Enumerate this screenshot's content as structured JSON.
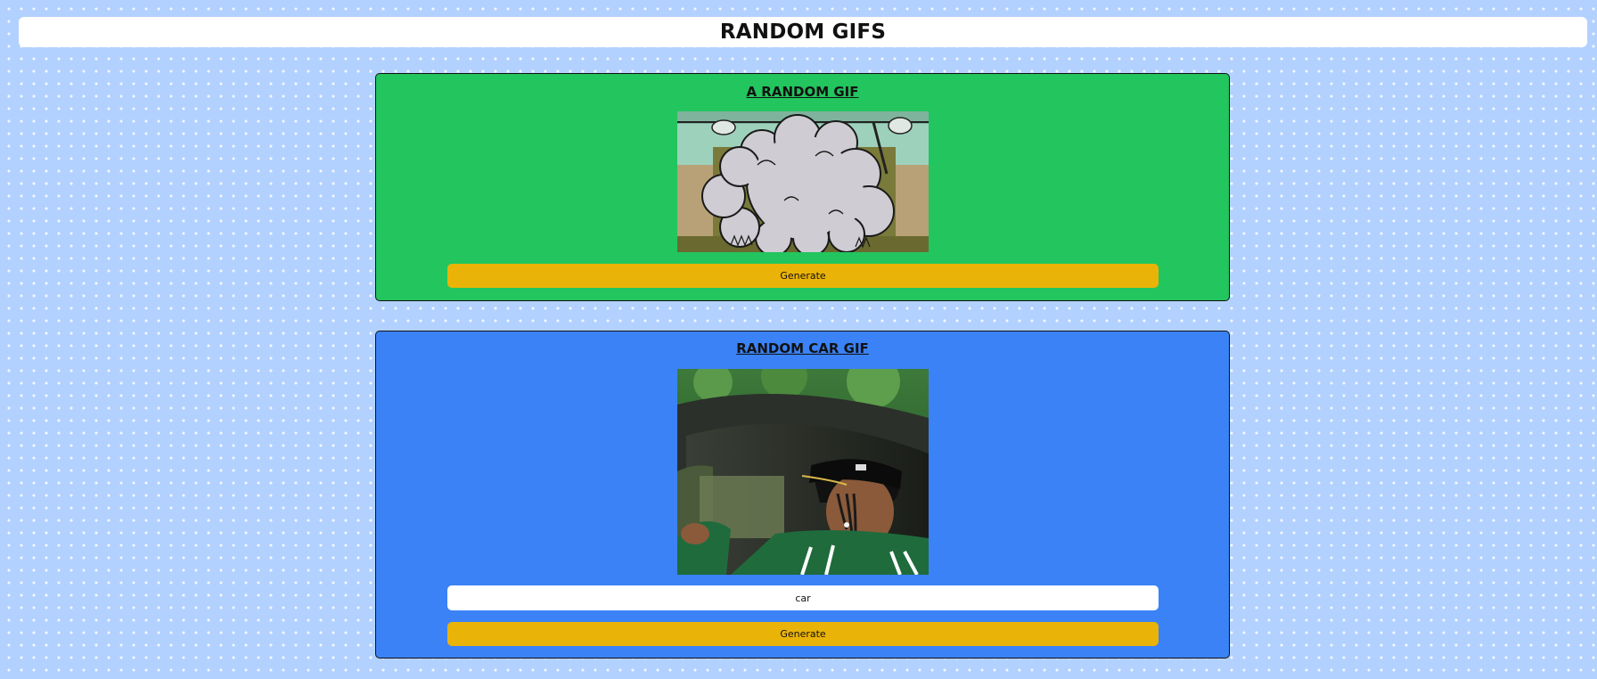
{
  "header": {
    "title": "RANDOM GIFS"
  },
  "random_card": {
    "title": "A RANDOM GIF",
    "image_alt": "cartoon smoke cloud gif",
    "generate_label": "Generate"
  },
  "tag_card": {
    "title": "RANDOM CAR GIF",
    "image_alt": "man smiling in car gif",
    "tag_input_value": "car",
    "generate_label": "Generate"
  },
  "colors": {
    "page_background": "#b3d1ff",
    "random_card_bg": "#22c55e",
    "tag_card_bg": "#3b82f6",
    "button_bg": "#eab308"
  }
}
